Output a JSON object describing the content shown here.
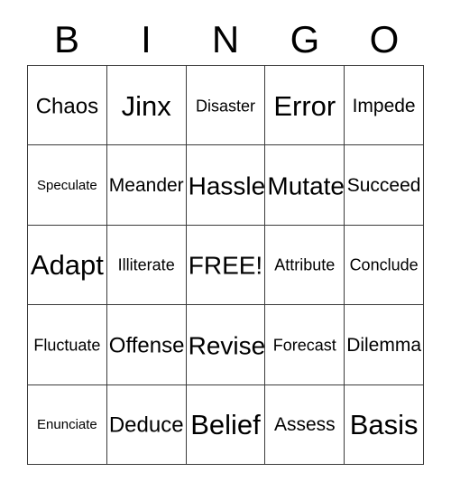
{
  "card": {
    "header_letters": [
      "B",
      "I",
      "N",
      "G",
      "O"
    ],
    "free_space_label": "FREE!",
    "colors": {
      "background": "#ffffff",
      "text": "#000000",
      "grid_line": "#3a3a3a"
    },
    "rows": [
      [
        {
          "label": "Chaos",
          "size": "l"
        },
        {
          "label": "Jinx",
          "size": "xxl"
        },
        {
          "label": "Disaster",
          "size": "s"
        },
        {
          "label": "Error",
          "size": "xxl"
        },
        {
          "label": "Impede",
          "size": "m"
        }
      ],
      [
        {
          "label": "Speculate",
          "size": "xs"
        },
        {
          "label": "Meander",
          "size": "m"
        },
        {
          "label": "Hassle",
          "size": "xl"
        },
        {
          "label": "Mutate",
          "size": "xl"
        },
        {
          "label": "Succeed",
          "size": "m"
        }
      ],
      [
        {
          "label": "Adapt",
          "size": "xxl"
        },
        {
          "label": "Illiterate",
          "size": "s"
        },
        {
          "label": "FREE!",
          "size": "xl"
        },
        {
          "label": "Attribute",
          "size": "s"
        },
        {
          "label": "Conclude",
          "size": "s"
        }
      ],
      [
        {
          "label": "Fluctuate",
          "size": "s"
        },
        {
          "label": "Offense",
          "size": "l"
        },
        {
          "label": "Revise",
          "size": "xl"
        },
        {
          "label": "Forecast",
          "size": "s"
        },
        {
          "label": "Dilemma",
          "size": "m"
        }
      ],
      [
        {
          "label": "Enunciate",
          "size": "xs"
        },
        {
          "label": "Deduce",
          "size": "l"
        },
        {
          "label": "Belief",
          "size": "xxl"
        },
        {
          "label": "Assess",
          "size": "m"
        },
        {
          "label": "Basis",
          "size": "xxl"
        }
      ]
    ]
  }
}
